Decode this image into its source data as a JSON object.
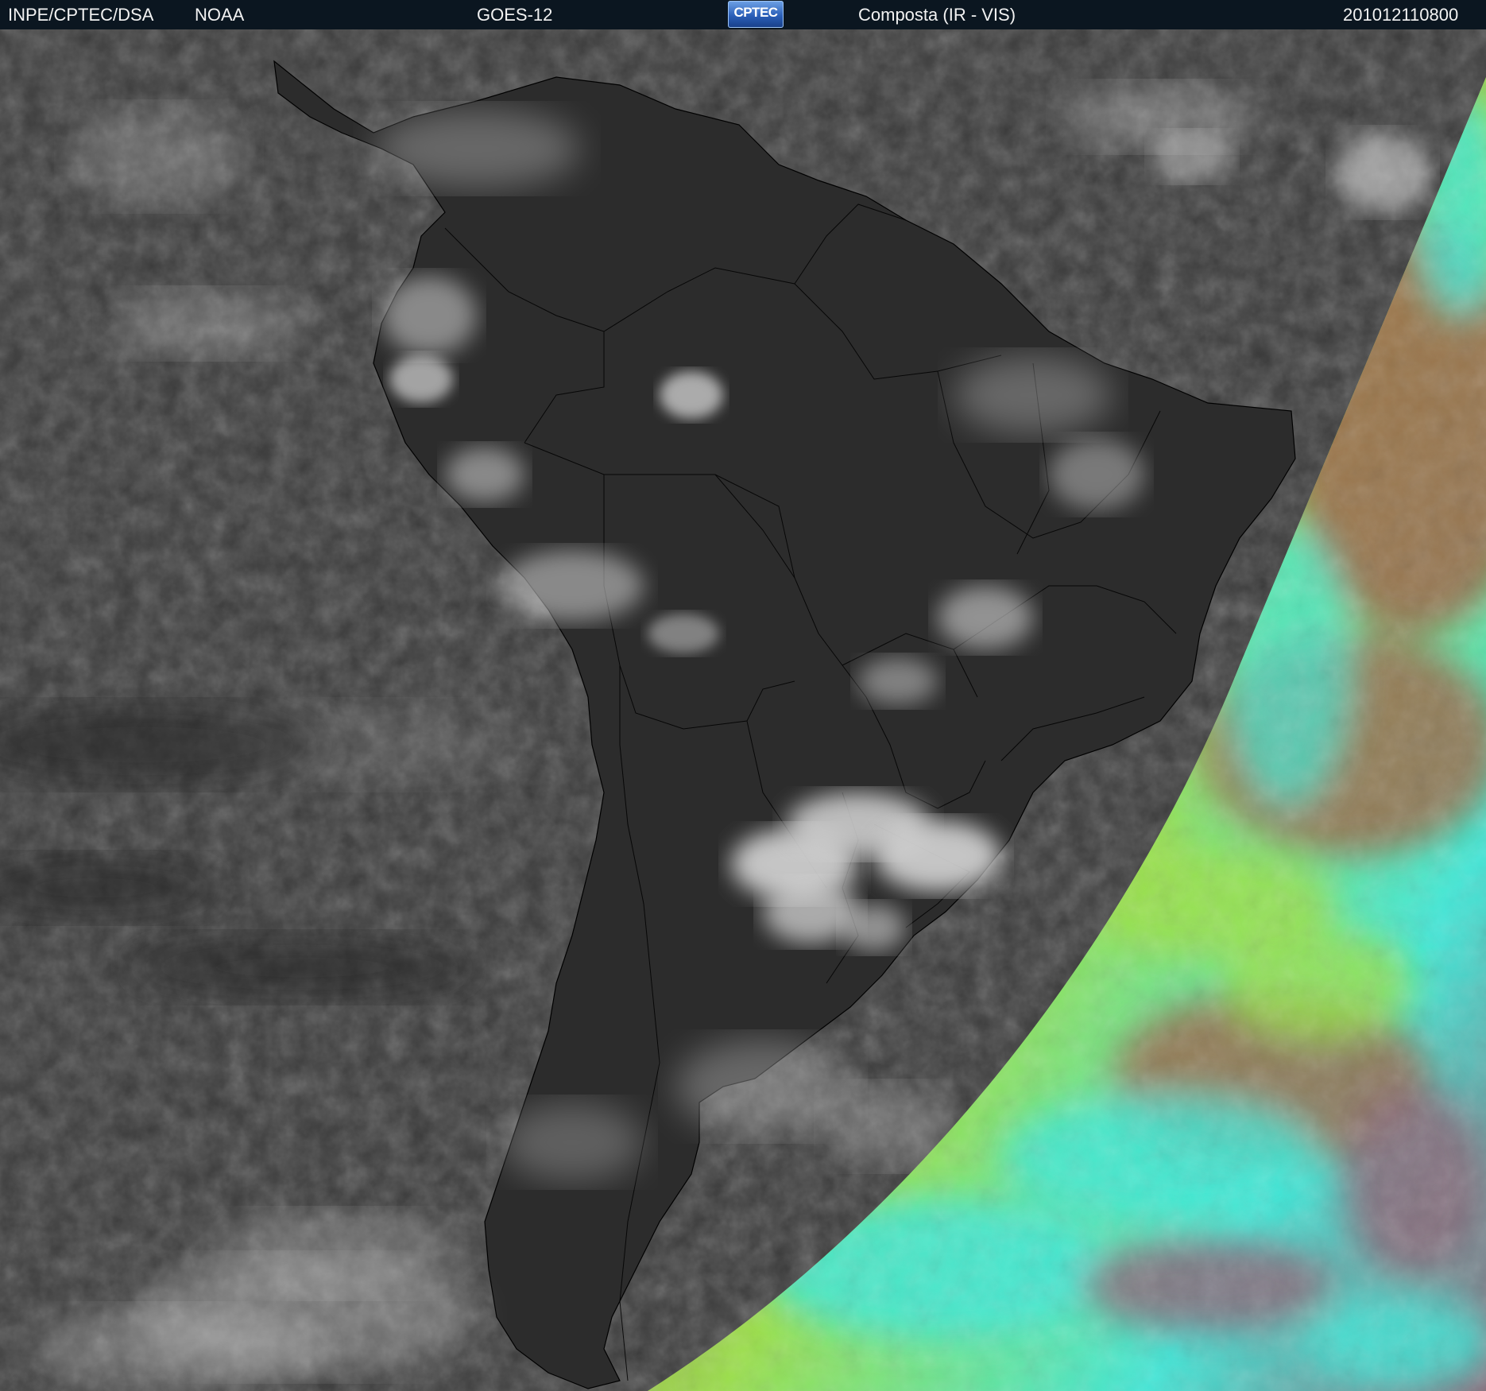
{
  "header": {
    "institution": "INPE/CPTEC/DSA",
    "agency": "NOAA",
    "satellite": "GOES-12",
    "logo_text": "CPTEC",
    "product": "Composta (IR - VIS)",
    "timestamp": "201012110800"
  },
  "colors": {
    "header_bg": "#0b1620",
    "ir_ocean": "#3a3a3a",
    "ir_land": "#2f2f2f",
    "ir_cloud": "#d6d6d6",
    "vis_brown": "#9a6a4a",
    "vis_green": "#9be04a",
    "vis_cyan": "#40e8d8",
    "vis_mauve": "#8a6878",
    "border_lines": "#000000"
  },
  "icons": [
    "cptec-logo"
  ]
}
